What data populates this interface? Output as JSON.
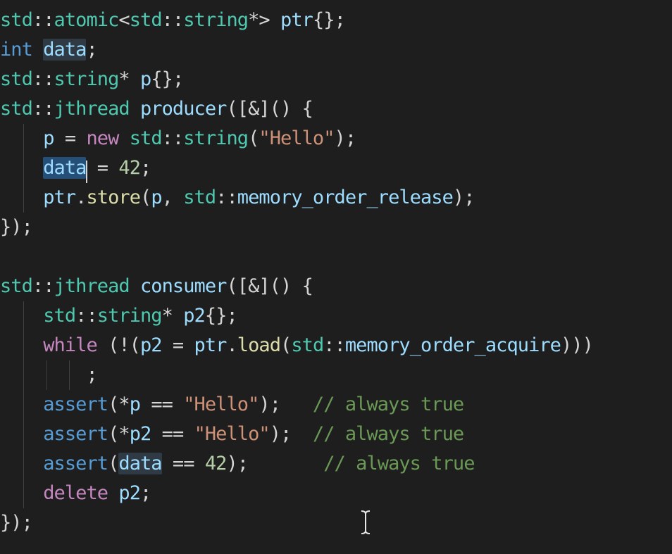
{
  "editor": {
    "theme": "dark",
    "colors": {
      "background": "#1e1e1e",
      "namespace": "#4ec9b0",
      "keyword": "#569cd6",
      "control": "#c586c0",
      "variable": "#9cdcfe",
      "function": "#dcdcaa",
      "number": "#b5cea8",
      "string": "#ce9178",
      "comment": "#6a9955",
      "selection": "#264f78",
      "word_highlight": "#2f3a44"
    },
    "mouse_cursor_icon": "text-cursor-ibeam-icon",
    "lines": [
      {
        "tokens": [
          {
            "t": "std",
            "c": "ns"
          },
          {
            "t": "::",
            "c": "punc"
          },
          {
            "t": "atomic",
            "c": "type"
          },
          {
            "t": "<",
            "c": "punc"
          },
          {
            "t": "std",
            "c": "ns"
          },
          {
            "t": "::",
            "c": "punc"
          },
          {
            "t": "string",
            "c": "type"
          },
          {
            "t": "*",
            "c": "punc"
          },
          {
            "t": "> ",
            "c": "punc"
          },
          {
            "t": "ptr",
            "c": "var"
          },
          {
            "t": "{};",
            "c": "punc"
          }
        ]
      },
      {
        "tokens": [
          {
            "t": "int",
            "c": "kw"
          },
          {
            "t": " ",
            "c": "ws"
          },
          {
            "t": "data",
            "c": "var",
            "hl": "hl"
          },
          {
            "t": ";",
            "c": "punc"
          }
        ]
      },
      {
        "tokens": [
          {
            "t": "std",
            "c": "ns"
          },
          {
            "t": "::",
            "c": "punc"
          },
          {
            "t": "string",
            "c": "type"
          },
          {
            "t": "* ",
            "c": "punc"
          },
          {
            "t": "p",
            "c": "var"
          },
          {
            "t": "{};",
            "c": "punc"
          }
        ]
      },
      {
        "tokens": [
          {
            "t": "std",
            "c": "ns"
          },
          {
            "t": "::",
            "c": "punc"
          },
          {
            "t": "jthread",
            "c": "type"
          },
          {
            "t": " ",
            "c": "ws"
          },
          {
            "t": "producer",
            "c": "var"
          },
          {
            "t": "([&]() {",
            "c": "punc"
          }
        ]
      },
      {
        "tokens": [
          {
            "t": "    ",
            "c": "ws"
          },
          {
            "t": "p",
            "c": "var"
          },
          {
            "t": " = ",
            "c": "punc"
          },
          {
            "t": "new",
            "c": "ctrl"
          },
          {
            "t": " ",
            "c": "ws"
          },
          {
            "t": "std",
            "c": "ns"
          },
          {
            "t": "::",
            "c": "punc"
          },
          {
            "t": "string",
            "c": "type"
          },
          {
            "t": "(",
            "c": "punc"
          },
          {
            "t": "\"Hello\"",
            "c": "str"
          },
          {
            "t": ");",
            "c": "punc"
          }
        ]
      },
      {
        "tokens": [
          {
            "t": "    ",
            "c": "ws"
          },
          {
            "t": "data",
            "c": "var",
            "hl": "sel"
          },
          {
            "t": " = ",
            "c": "punc"
          },
          {
            "t": "42",
            "c": "num"
          },
          {
            "t": ";",
            "c": "punc"
          }
        ]
      },
      {
        "tokens": [
          {
            "t": "    ",
            "c": "ws"
          },
          {
            "t": "ptr",
            "c": "var"
          },
          {
            "t": ".",
            "c": "punc"
          },
          {
            "t": "store",
            "c": "fn"
          },
          {
            "t": "(",
            "c": "punc"
          },
          {
            "t": "p",
            "c": "var"
          },
          {
            "t": ", ",
            "c": "punc"
          },
          {
            "t": "std",
            "c": "ns"
          },
          {
            "t": "::",
            "c": "punc"
          },
          {
            "t": "memory_order_release",
            "c": "var"
          },
          {
            "t": ");",
            "c": "punc"
          }
        ]
      },
      {
        "tokens": [
          {
            "t": "});",
            "c": "punc"
          }
        ]
      },
      {
        "tokens": []
      },
      {
        "tokens": [
          {
            "t": "std",
            "c": "ns"
          },
          {
            "t": "::",
            "c": "punc"
          },
          {
            "t": "jthread",
            "c": "type"
          },
          {
            "t": " ",
            "c": "ws"
          },
          {
            "t": "consumer",
            "c": "var"
          },
          {
            "t": "([&]() {",
            "c": "punc"
          }
        ]
      },
      {
        "tokens": [
          {
            "t": "    ",
            "c": "ws"
          },
          {
            "t": "std",
            "c": "ns"
          },
          {
            "t": "::",
            "c": "punc"
          },
          {
            "t": "string",
            "c": "type"
          },
          {
            "t": "* ",
            "c": "punc"
          },
          {
            "t": "p2",
            "c": "var"
          },
          {
            "t": "{};",
            "c": "punc"
          }
        ]
      },
      {
        "tokens": [
          {
            "t": "    ",
            "c": "ws"
          },
          {
            "t": "while",
            "c": "ctrl"
          },
          {
            "t": " (!(",
            "c": "punc"
          },
          {
            "t": "p2",
            "c": "var"
          },
          {
            "t": " = ",
            "c": "punc"
          },
          {
            "t": "ptr",
            "c": "var"
          },
          {
            "t": ".",
            "c": "punc"
          },
          {
            "t": "load",
            "c": "fn"
          },
          {
            "t": "(",
            "c": "punc"
          },
          {
            "t": "std",
            "c": "ns"
          },
          {
            "t": "::",
            "c": "punc"
          },
          {
            "t": "memory_order_acquire",
            "c": "var"
          },
          {
            "t": ")))",
            "c": "punc"
          }
        ]
      },
      {
        "tokens": [
          {
            "t": "        ",
            "c": "ws"
          },
          {
            "t": ";",
            "c": "punc"
          }
        ]
      },
      {
        "tokens": [
          {
            "t": "    ",
            "c": "ws"
          },
          {
            "t": "assert",
            "c": "kw"
          },
          {
            "t": "(*",
            "c": "punc"
          },
          {
            "t": "p",
            "c": "var"
          },
          {
            "t": " == ",
            "c": "punc"
          },
          {
            "t": "\"Hello\"",
            "c": "str"
          },
          {
            "t": ");   ",
            "c": "punc"
          },
          {
            "t": "// always true",
            "c": "com"
          }
        ]
      },
      {
        "tokens": [
          {
            "t": "    ",
            "c": "ws"
          },
          {
            "t": "assert",
            "c": "kw"
          },
          {
            "t": "(*",
            "c": "punc"
          },
          {
            "t": "p2",
            "c": "var"
          },
          {
            "t": " == ",
            "c": "punc"
          },
          {
            "t": "\"Hello\"",
            "c": "str"
          },
          {
            "t": ");  ",
            "c": "punc"
          },
          {
            "t": "// always true",
            "c": "com"
          }
        ]
      },
      {
        "tokens": [
          {
            "t": "    ",
            "c": "ws"
          },
          {
            "t": "assert",
            "c": "kw"
          },
          {
            "t": "(",
            "c": "punc"
          },
          {
            "t": "data",
            "c": "var",
            "hl": "hl"
          },
          {
            "t": " == ",
            "c": "punc"
          },
          {
            "t": "42",
            "c": "num"
          },
          {
            "t": ");       ",
            "c": "punc"
          },
          {
            "t": "// always true",
            "c": "com"
          }
        ]
      },
      {
        "tokens": [
          {
            "t": "    ",
            "c": "ws"
          },
          {
            "t": "delete",
            "c": "ctrl"
          },
          {
            "t": " ",
            "c": "ws"
          },
          {
            "t": "p2",
            "c": "var"
          },
          {
            "t": ";",
            "c": "punc"
          }
        ]
      },
      {
        "tokens": [
          {
            "t": "});",
            "c": "punc"
          }
        ]
      }
    ]
  }
}
